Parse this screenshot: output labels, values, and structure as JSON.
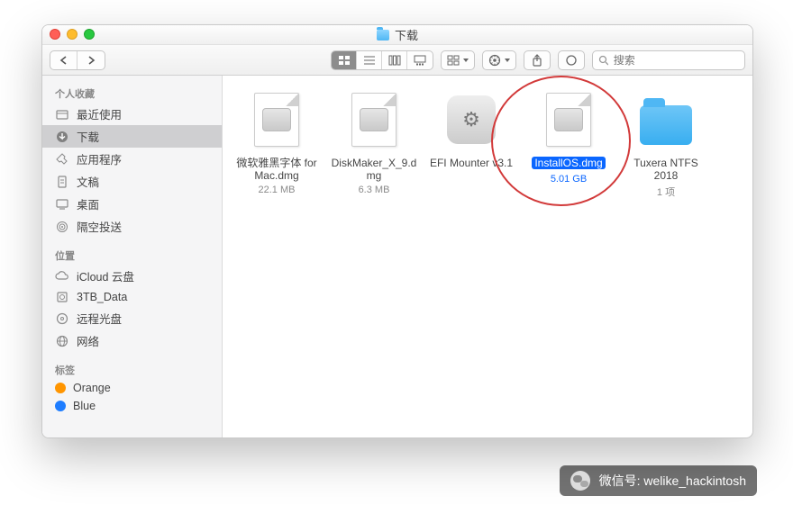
{
  "window": {
    "title": "下载"
  },
  "toolbar": {
    "search_placeholder": "搜索"
  },
  "sidebar": {
    "sections": [
      {
        "header": "个人收藏",
        "items": [
          {
            "icon": "recent-icon",
            "label": "最近使用"
          },
          {
            "icon": "download-icon",
            "label": "下载",
            "selected": true
          },
          {
            "icon": "applications-icon",
            "label": "应用程序"
          },
          {
            "icon": "documents-icon",
            "label": "文稿"
          },
          {
            "icon": "desktop-icon",
            "label": "桌面"
          },
          {
            "icon": "airdrop-icon",
            "label": "隔空投送"
          }
        ]
      },
      {
        "header": "位置",
        "items": [
          {
            "icon": "icloud-icon",
            "label": "iCloud 云盘"
          },
          {
            "icon": "disk-icon",
            "label": "3TB_Data"
          },
          {
            "icon": "optical-icon",
            "label": "远程光盘"
          },
          {
            "icon": "network-icon",
            "label": "网络"
          }
        ]
      },
      {
        "header": "标签",
        "items": [
          {
            "icon": "tag-orange",
            "label": "Orange"
          },
          {
            "icon": "tag-blue",
            "label": "Blue"
          }
        ]
      }
    ]
  },
  "files": [
    {
      "kind": "dmg",
      "name": "微软雅黑字体 for Mac.dmg",
      "sub": "22.1 MB"
    },
    {
      "kind": "dmg",
      "name": "DiskMaker_X_9.dmg",
      "sub": "6.3 MB"
    },
    {
      "kind": "app",
      "name": "EFI Mounter v3.1",
      "sub": ""
    },
    {
      "kind": "dmg",
      "name": "InstallOS.dmg",
      "sub": "5.01 GB",
      "selected": true
    },
    {
      "kind": "folder",
      "name": "Tuxera NTFS 2018",
      "sub": "1 项"
    }
  ],
  "overlay": {
    "label": "微信号: welike_hackintosh"
  }
}
